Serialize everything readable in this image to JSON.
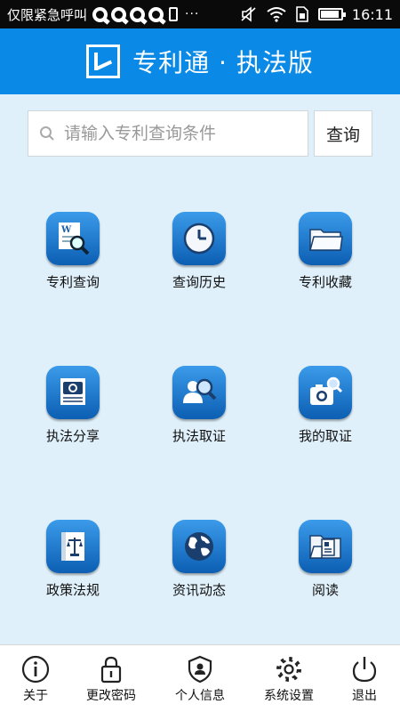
{
  "status_bar": {
    "carrier": "仅限紧急呼叫",
    "dots": "···",
    "time": "16:11",
    "battery_level": 0.9
  },
  "header": {
    "title": "专利通 · 执法版",
    "background_color": "#0a8ae6"
  },
  "search": {
    "placeholder": "请输入专利查询条件",
    "value": "",
    "button_label": "查询"
  },
  "grid": {
    "items": [
      {
        "label": "专利查询",
        "icon": "document-search-icon"
      },
      {
        "label": "查询历史",
        "icon": "clock-icon"
      },
      {
        "label": "专利收藏",
        "icon": "folder-icon"
      },
      {
        "label": "执法分享",
        "icon": "camera-share-icon"
      },
      {
        "label": "执法取证",
        "icon": "person-search-icon"
      },
      {
        "label": "我的取证",
        "icon": "camera-search-icon"
      },
      {
        "label": "政策法规",
        "icon": "law-book-icon"
      },
      {
        "label": "资讯动态",
        "icon": "globe-icon"
      },
      {
        "label": "阅读",
        "icon": "reading-folder-icon"
      }
    ]
  },
  "bottom_nav": {
    "items": [
      {
        "label": "关于",
        "icon": "info-icon"
      },
      {
        "label": "更改密码",
        "icon": "lock-icon"
      },
      {
        "label": "个人信息",
        "icon": "user-shield-icon"
      },
      {
        "label": "系统设置",
        "icon": "gear-icon"
      },
      {
        "label": "退出",
        "icon": "power-icon"
      }
    ]
  }
}
